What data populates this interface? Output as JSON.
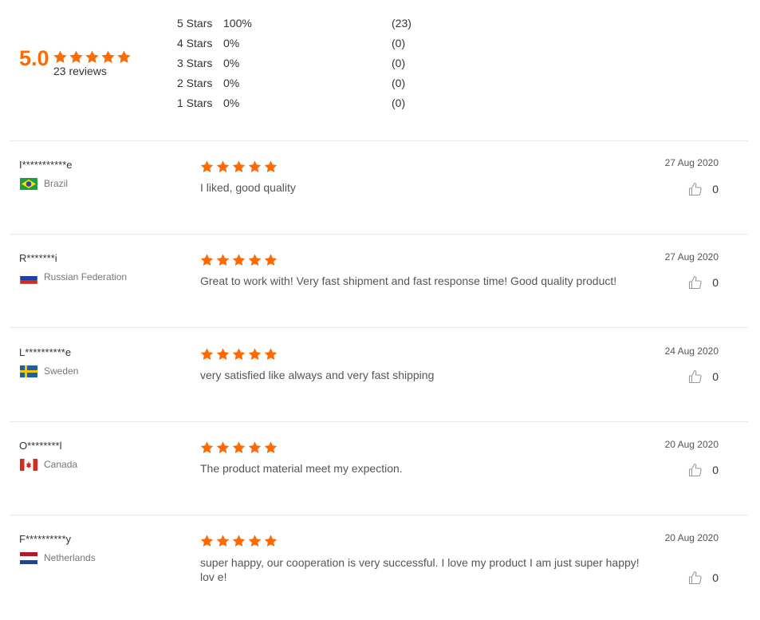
{
  "summary": {
    "average": "5.0",
    "reviews_label": "23 reviews",
    "distribution": [
      {
        "label": "5  Stars",
        "percent": "100%",
        "count": "(23)"
      },
      {
        "label": "4  Stars",
        "percent": "0%",
        "count": "(0)"
      },
      {
        "label": "3  Stars",
        "percent": "0%",
        "count": "(0)"
      },
      {
        "label": "2  Stars",
        "percent": "0%",
        "count": "(0)"
      },
      {
        "label": "1  Stars",
        "percent": "0%",
        "count": "(0)"
      }
    ],
    "rating": 5
  },
  "colors": {
    "star": "#ff6a00",
    "accent": "#ff6a00"
  },
  "reviews": [
    {
      "name": "I***********e",
      "country": "Brazil",
      "flag": "brazil-flag",
      "rating": 5,
      "text": "I liked, good quality",
      "date": "27 Aug 2020",
      "likes": "0"
    },
    {
      "name": "R*******i",
      "country": "Russian Federation",
      "flag": "russia-flag",
      "rating": 5,
      "text": "Great to work with! Very fast shipment and fast response time! Good quality product!",
      "date": "27 Aug 2020",
      "likes": "0"
    },
    {
      "name": "L**********e",
      "country": "Sweden",
      "flag": "sweden-flag",
      "rating": 5,
      "text": "very satisfied like always and very fast shipping",
      "date": "24 Aug 2020",
      "likes": "0"
    },
    {
      "name": "O********l",
      "country": "Canada",
      "flag": "canada-flag",
      "rating": 5,
      "text": "The product material meet my expection.",
      "date": "20 Aug 2020",
      "likes": "0"
    },
    {
      "name": "F**********y",
      "country": "Netherlands",
      "flag": "netherlands-flag",
      "rating": 5,
      "text": "super happy, our cooperation is very successful. I love my product I am just super happy! lov e!",
      "date": "20 Aug 2020",
      "likes": "0"
    }
  ]
}
